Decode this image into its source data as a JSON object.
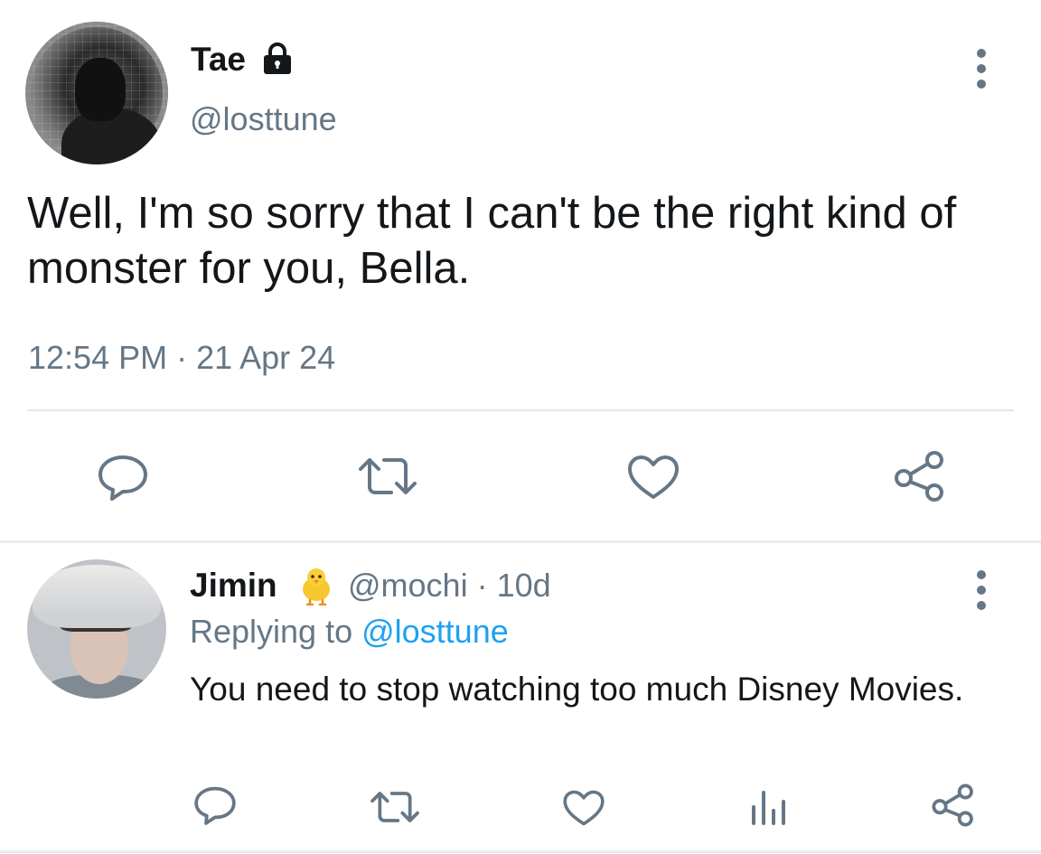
{
  "main_tweet": {
    "display_name": "Tae",
    "handle": "@losttune",
    "text": "Well, I'm so sorry that I can't be the right kind of monster for you, Bella.",
    "timestamp": "12:54 PM · 21 Apr 24",
    "icons": {
      "verified_lock": "lock-icon",
      "more": "more-vertical-icon",
      "reply": "reply-icon",
      "retweet": "retweet-icon",
      "like": "heart-icon",
      "share": "share-icon"
    }
  },
  "reply": {
    "display_name": "Jimin",
    "emoji": "🐥",
    "handle_time": "@mochi · 10d",
    "replying_prefix": "Replying to ",
    "replying_mention": "@losttune",
    "text": "You need to stop watching too much Disney Movies.",
    "icons": {
      "more": "more-vertical-icon",
      "reply": "reply-icon",
      "retweet": "retweet-icon",
      "like": "heart-icon",
      "analytics": "analytics-icon",
      "share": "share-icon"
    }
  },
  "colors": {
    "text_primary": "#14171a",
    "text_secondary": "#657786",
    "link": "#1da1f2",
    "divider": "#e1e8ed"
  }
}
